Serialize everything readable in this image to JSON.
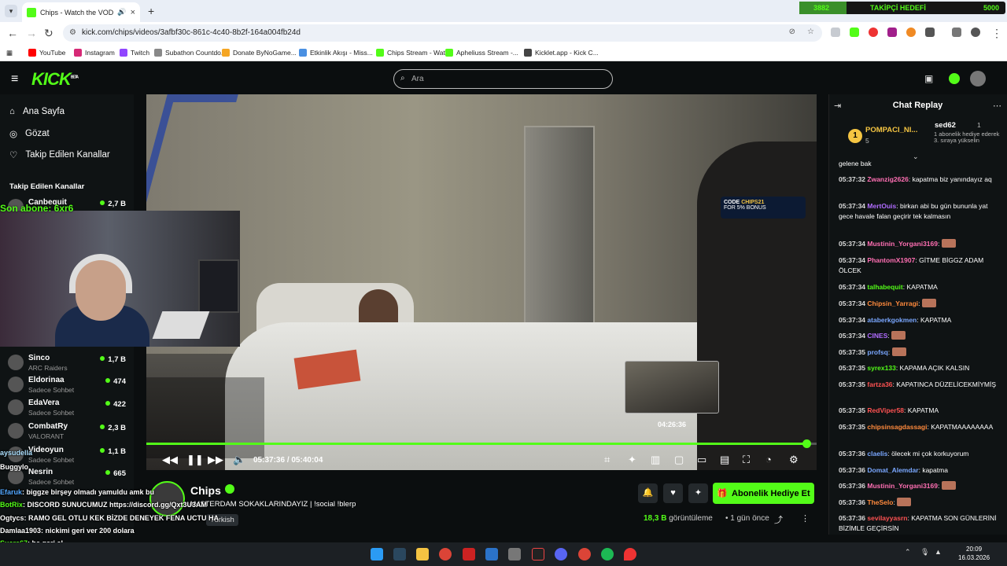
{
  "browser": {
    "tab_title": "Chips - Watch the VOD on",
    "url": "kick.com/chips/videos/3afbf30c-861c-4c40-8b2f-164a004fb24d",
    "bookmarks": [
      {
        "label": "YouTube",
        "color": "#ff0000"
      },
      {
        "label": "Instagram",
        "color": "#d62976"
      },
      {
        "label": "Twitch",
        "color": "#9146ff"
      },
      {
        "label": "Subathon Countdo...",
        "color": "#888888"
      },
      {
        "label": "Donate ByNoGame...",
        "color": "#f5a623"
      },
      {
        "label": "Etkinlik Akışı - Miss...",
        "color": "#4a90e2"
      },
      {
        "label": "Chips Stream - Wat...",
        "color": "#53fc18"
      },
      {
        "label": "Apheliuss Stream -...",
        "color": "#53fc18"
      },
      {
        "label": "Kicklet.app - Kick C...",
        "color": "#444444"
      }
    ]
  },
  "hud": {
    "left": "3882",
    "middle": "TAKİPÇİ HEDEFİ",
    "right": "5000"
  },
  "kick": {
    "logo": "KICK",
    "logo_badge": "BETA",
    "search_placeholder": "Ara",
    "nav": [
      {
        "label": "Ana Sayfa",
        "icon": "home-icon"
      },
      {
        "label": "Gözat",
        "icon": "compass-icon"
      },
      {
        "label": "Takip Edilen Kanallar",
        "icon": "heart-icon"
      }
    ],
    "following_heading": "Takip Edilen Kanallar",
    "channels": [
      {
        "name": "Canbequit",
        "game": "",
        "viewers": "2,7 B"
      },
      {
        "name": "Sinco",
        "game": "ARC Raiders",
        "viewers": "1,7 B"
      },
      {
        "name": "Eldorinaa",
        "game": "Sadece Sohbet",
        "viewers": "474"
      },
      {
        "name": "EdaVera",
        "game": "Sadece Sohbet",
        "viewers": "422"
      },
      {
        "name": "CombatRy",
        "game": "VALORANT",
        "viewers": "2,3 B"
      },
      {
        "name": "Videoyun",
        "game": "Sadece Sohbet",
        "viewers": "1,1 B"
      },
      {
        "name": "Nesrin",
        "game": "Sadece Sohbet",
        "viewers": "665"
      }
    ]
  },
  "player": {
    "sponsor_code": "CODE",
    "sponsor_code_value": "CHIPS21",
    "sponsor_sub": "FOR 5% BONUS",
    "hover_time": "04:26:36",
    "current_time": "05:37:36",
    "separator": "/",
    "duration": "05:40:04",
    "progress": 0.985
  },
  "facecam": {
    "overlay": "Son abone: 6xr6"
  },
  "overlay_chat": [
    {
      "user": "aysudella",
      "text": "",
      "color": "#aee1ff"
    },
    {
      "user": "Buggylo",
      "text": "",
      "color": "#ffffff"
    },
    {
      "user": "Efaruk",
      "text": "biggze birşey olmadı yamuldu amk bu",
      "color": "#53a8ff"
    },
    {
      "user": "BotRix",
      "text": "DISCORD SUNUCUMUZ https://discord.gg/Qxt3U3AM",
      "color": "#53fc18"
    },
    {
      "user": "Ogtycs",
      "text": "RAMO GEL OTLU KEK BİZDE DENEYEK FENA UCTU HA",
      "color": "#ffffff"
    },
    {
      "user": "Damlaa1903",
      "text": "nickimi geri ver 200 dolara",
      "color": "#ffffff"
    },
    {
      "user": "Sucre67",
      "text": "he geri al",
      "color": "#53fc18"
    },
    {
      "user": "Redtix",
      "text": "evet",
      "color": "#53fc18"
    }
  ],
  "stream": {
    "channel": "Chips",
    "title": "AMSTERDAM SOKAKLARINDAYIZ | !social !blerp",
    "category": "Turkish",
    "gift_button": "Abonelik Hediye Et",
    "views": "18,3 B",
    "views_label": "görüntüleme",
    "ago": "1 gün önce"
  },
  "chat": {
    "title": "Chat Replay",
    "pinned": {
      "rank": "1",
      "top_user": "POMPACI_NI...",
      "top_count": "5",
      "gifter": "sed62",
      "gifter_count": "1",
      "gifter_text": "1 abonelik hediye ederek 3. sıraya yükselin"
    },
    "messages": [
      {
        "time": "",
        "user": "",
        "text": "gelene bak",
        "color": "#ffffff"
      },
      {
        "time": "05:37:32",
        "user": "Zwanzig2626",
        "text": "kapatma biz yanındayız aq",
        "color": "#ff6fb3"
      },
      {
        "time": "05:37:34",
        "user": "MertOuis",
        "text": "birkan abi bu gün bununla yat gece havale falan geçirir tek kalmasın",
        "color": "#b06cff"
      },
      {
        "time": "05:37:34",
        "user": "Mustinin_Yorgani3169",
        "text": "",
        "color": "#ff6fb3"
      },
      {
        "time": "05:37:34",
        "user": "PhantomX1907",
        "text": "GİTME BİGGZ ADAM ÖLCEK",
        "color": "#ff6fb3"
      },
      {
        "time": "05:37:34",
        "user": "talhabequit",
        "text": "KAPATMA",
        "color": "#53fc18"
      },
      {
        "time": "05:37:34",
        "user": "Chipsin_Yarragi",
        "text": "",
        "color": "#ff8a3d"
      },
      {
        "time": "05:37:34",
        "user": "ataberkgokmen",
        "text": "KAPATMA",
        "color": "#7aa7ff"
      },
      {
        "time": "05:37:34",
        "user": "CINES",
        "text": "",
        "color": "#b06cff"
      },
      {
        "time": "05:37:35",
        "user": "profsq",
        "text": "",
        "color": "#7aa7ff"
      },
      {
        "time": "05:37:35",
        "user": "syrex133",
        "text": "KAPAMA AÇIK KALSIN",
        "color": "#53fc18"
      },
      {
        "time": "05:37:35",
        "user": "fartza36",
        "text": "KAPATINCA DÜZELİCEKMİYMİŞ",
        "color": "#ff5252"
      },
      {
        "time": "05:37:35",
        "user": "RedViper58",
        "text": "KAPATMA",
        "color": "#ff5252"
      },
      {
        "time": "05:37:35",
        "user": "chipsinsagdassagi",
        "text": "KAPATMAAAAAAAA",
        "color": "#ff8a3d"
      },
      {
        "time": "05:37:36",
        "user": "claelis",
        "text": "ölecek mi çok korkuyorum",
        "color": "#7aa7ff"
      },
      {
        "time": "05:37:36",
        "user": "Domat_Alemdar",
        "text": "kapatma",
        "color": "#7aa7ff"
      },
      {
        "time": "05:37:36",
        "user": "Mustinin_Yorgani3169",
        "text": "",
        "color": "#ff6fb3"
      },
      {
        "time": "05:37:36",
        "user": "TheSelo",
        "text": "",
        "color": "#ff8a3d"
      },
      {
        "time": "05:37:36",
        "user": "sevilayyasrn",
        "text": "KAPATMA SON GÜNLERİNİ BİZİMLE GEÇİRSİN",
        "color": "#ff5252"
      }
    ]
  },
  "taskbar": {
    "time": "20:09",
    "date": "16.03.2026"
  }
}
